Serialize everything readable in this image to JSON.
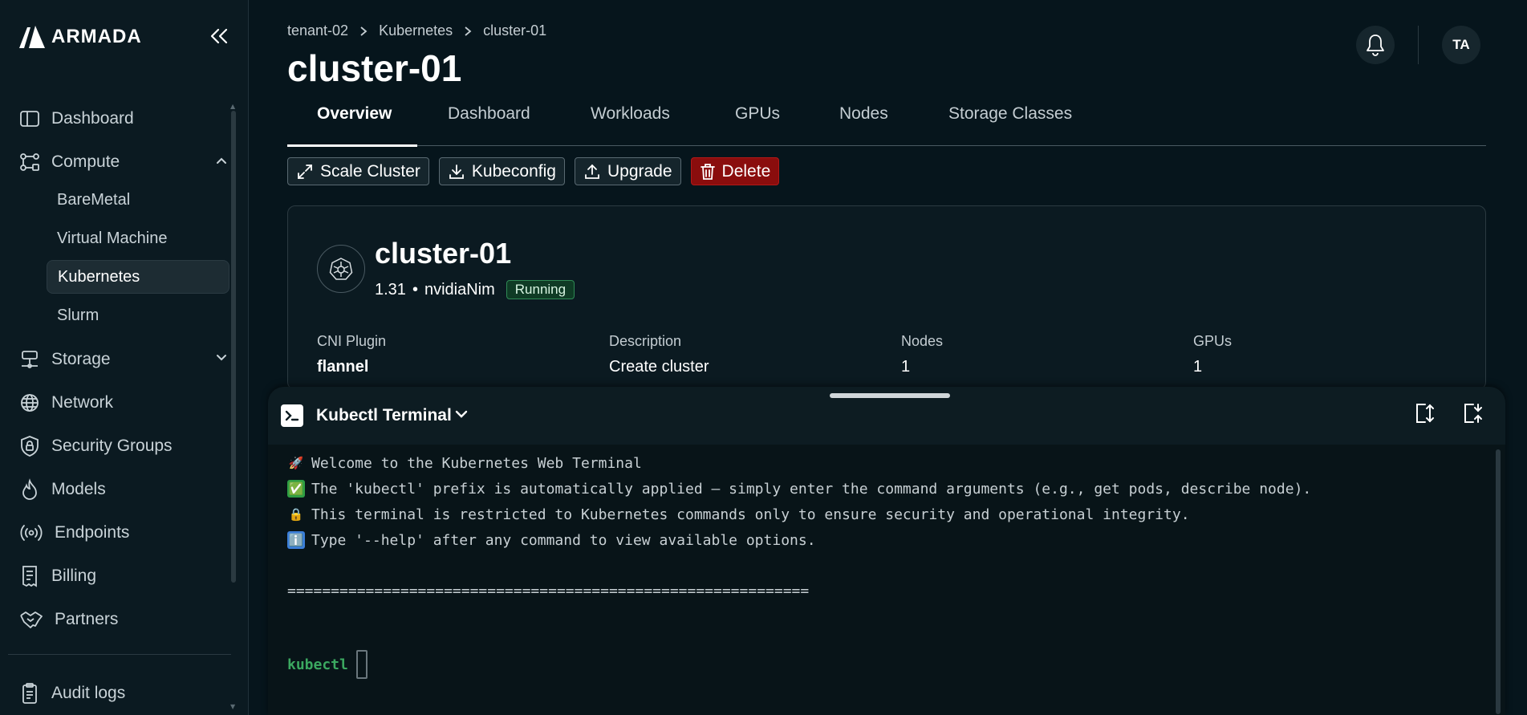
{
  "brand": {
    "name": "ARMADA"
  },
  "sidebar": {
    "items": [
      {
        "label": "Dashboard",
        "icon": "sidebar-icon"
      },
      {
        "label": "Compute",
        "icon": "compute-icon"
      },
      {
        "label": "Storage",
        "icon": "storage-icon"
      },
      {
        "label": "Network",
        "icon": "globe-icon"
      },
      {
        "label": "Security Groups",
        "icon": "shield-lock-icon"
      },
      {
        "label": "Models",
        "icon": "flame-icon"
      },
      {
        "label": "Endpoints",
        "icon": "broadcast-icon"
      },
      {
        "label": "Billing",
        "icon": "receipt-icon"
      },
      {
        "label": "Partners",
        "icon": "handshake-icon"
      },
      {
        "label": "Audit logs",
        "icon": "clipboard-icon"
      }
    ],
    "compute_sub": [
      "BareMetal",
      "Virtual Machine",
      "Kubernetes",
      "Slurm"
    ],
    "active_sub": "Kubernetes"
  },
  "header": {
    "breadcrumb": [
      "tenant-02",
      "Kubernetes",
      "cluster-01"
    ],
    "title": "cluster-01",
    "avatar_initials": "TA"
  },
  "tabs": [
    "Overview",
    "Dashboard",
    "Workloads",
    "GPUs",
    "Nodes",
    "Storage Classes"
  ],
  "actions": {
    "scale": "Scale Cluster",
    "kubeconfig": "Kubeconfig",
    "upgrade": "Upgrade",
    "delete": "Delete"
  },
  "cluster": {
    "name": "cluster-01",
    "version": "1.31",
    "separator": "•",
    "flavor": "nvidiaNim",
    "status": "Running",
    "fields": [
      {
        "label": "CNI Plugin",
        "value": "flannel"
      },
      {
        "label": "Description",
        "value": "Create cluster"
      },
      {
        "label": "Nodes",
        "value": "1"
      },
      {
        "label": "GPUs",
        "value": "1"
      }
    ]
  },
  "terminal": {
    "title": "Kubectl Terminal",
    "lines": [
      {
        "emoji": "🚀",
        "text": "Welcome to the Kubernetes Web Terminal"
      },
      {
        "emoji": "✅",
        "text": "The 'kubectl' prefix is automatically applied — simply enter the command arguments (e.g., get pods, describe node)."
      },
      {
        "emoji": "🔒",
        "text": "This terminal is restricted to Kubernetes commands only to ensure security and operational integrity."
      },
      {
        "emoji": "ℹ️",
        "text": "Type '--help' after any command to view available options."
      }
    ],
    "separator": "============================================================",
    "prompt": "kubectl"
  },
  "colors": {
    "background": "#06151c",
    "sidebar": "#0b1a21",
    "danger": "#8a0d0d",
    "running": "#2f8a55",
    "prompt": "#3ba860"
  }
}
